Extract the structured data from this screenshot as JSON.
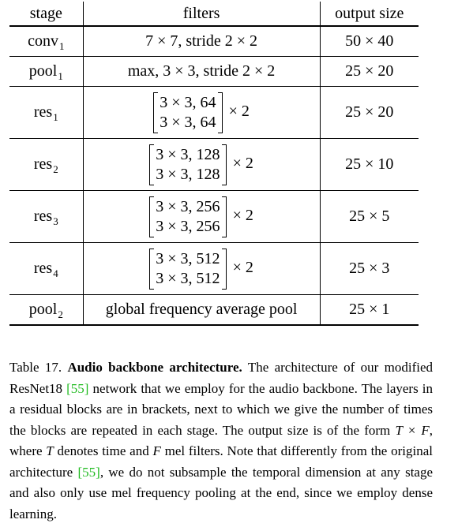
{
  "table": {
    "headers": [
      "stage",
      "filters",
      "output size"
    ],
    "rows": [
      {
        "stage": "conv",
        "stage_sub": "1",
        "filters": "7 × 7, stride 2 × 2",
        "output": "50 × 40"
      },
      {
        "stage": "pool",
        "stage_sub": "1",
        "filters": "max, 3 × 3, stride 2 × 2",
        "output": "25 × 20"
      },
      {
        "stage": "res",
        "stage_sub": "1",
        "block": [
          "3 × 3, 64",
          "3 × 3, 64"
        ],
        "repeat": "× 2",
        "output": "25 × 20"
      },
      {
        "stage": "res",
        "stage_sub": "2",
        "block": [
          "3 × 3, 128",
          "3 × 3, 128"
        ],
        "repeat": "× 2",
        "output": "25 × 10"
      },
      {
        "stage": "res",
        "stage_sub": "3",
        "block": [
          "3 × 3, 256",
          "3 × 3, 256"
        ],
        "repeat": "× 2",
        "output": "25 × 5"
      },
      {
        "stage": "res",
        "stage_sub": "4",
        "block": [
          "3 × 3, 512",
          "3 × 3, 512"
        ],
        "repeat": "× 2",
        "output": "25 × 3"
      },
      {
        "stage": "pool",
        "stage_sub": "2",
        "filters": "global frequency average pool",
        "output": "25 × 1"
      }
    ]
  },
  "caption": {
    "label": "Table 17.",
    "title": "Audio backbone architecture.",
    "seg1": "The architecture of our modified ResNet18 ",
    "cite1": "[55]",
    "seg2": " network that we employ for the audio backbone. The layers in a residual blocks are in brackets, next to which we give the number of times the blocks are repeated in each stage. The output size is of the form ",
    "math1": "T × F",
    "seg3": ", where ",
    "math2": "T",
    "seg4": " denotes time and ",
    "math3": "F",
    "seg5": " mel filters.  Note that differently from the original architecture ",
    "cite2": "[55]",
    "seg6": ", we do not subsample the temporal dimension at any stage and also only use mel frequency pooling at the end, since we employ dense learning."
  },
  "colors": {
    "citation": "#22bb22"
  }
}
